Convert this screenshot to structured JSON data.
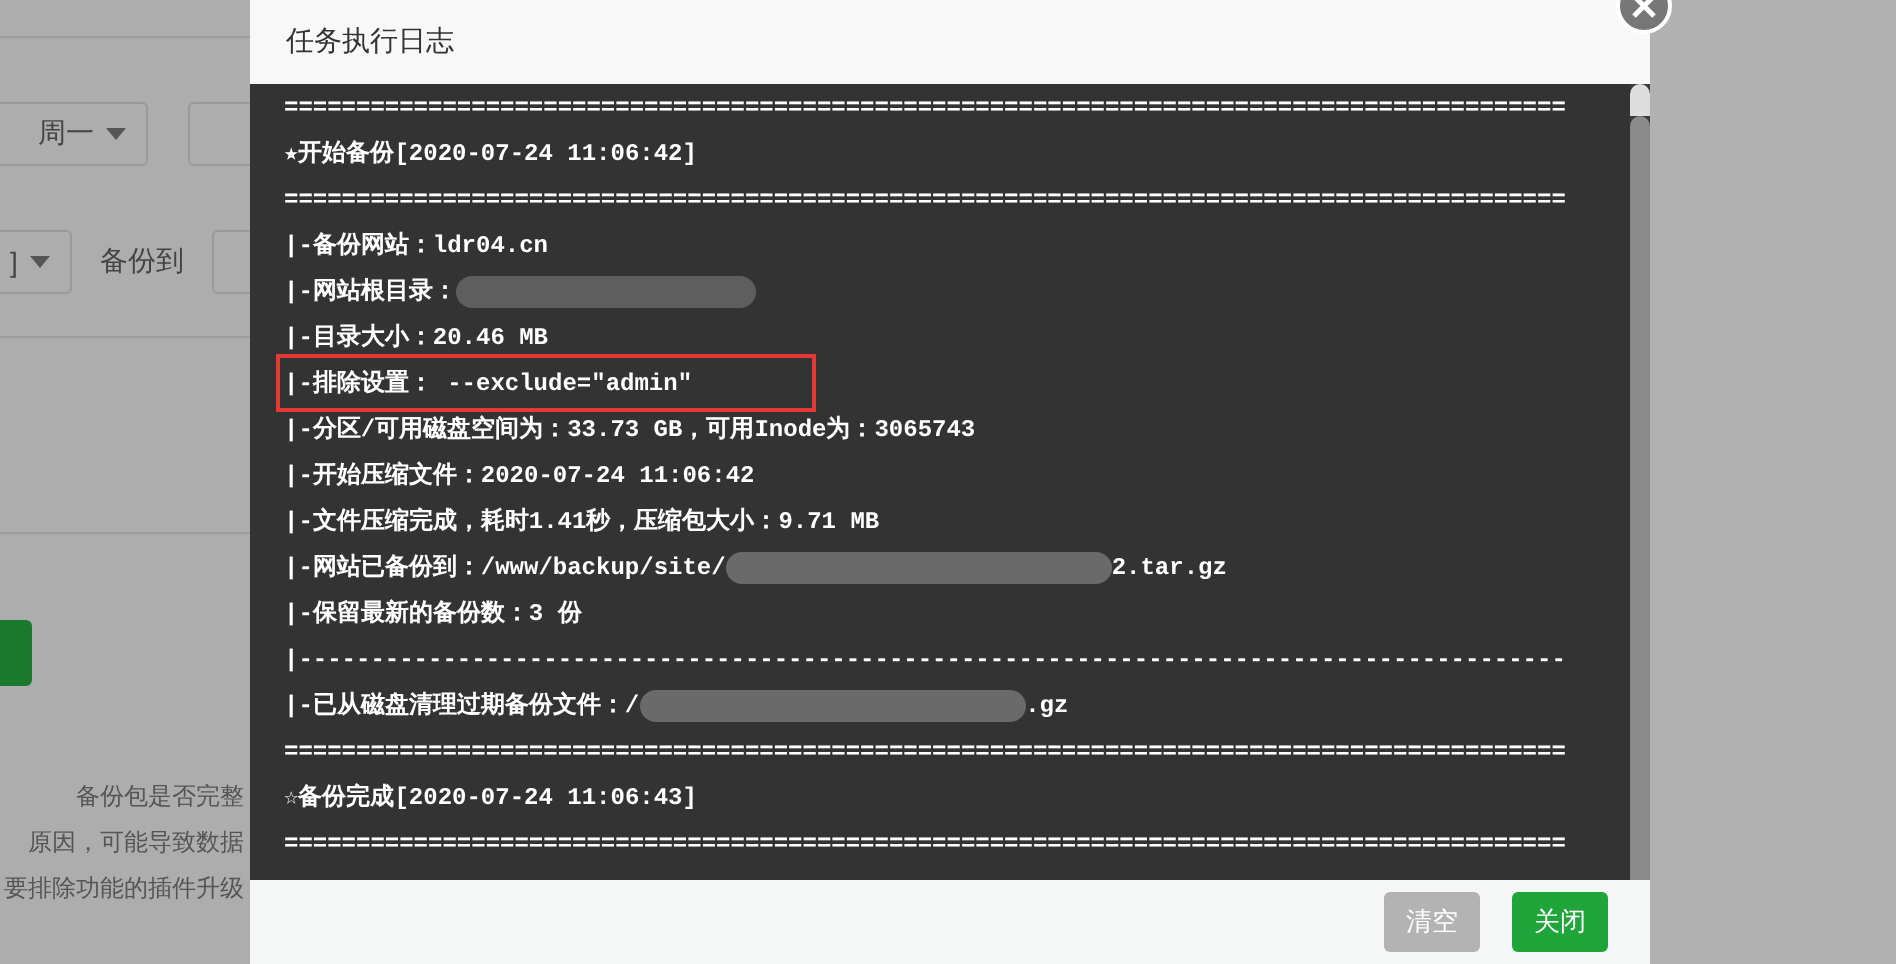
{
  "background_page": {
    "row_1": [
      {
        "kind": "dropdown",
        "label": "周一"
      },
      {
        "kind": "field"
      }
    ],
    "row_2": [
      {
        "kind": "dropdown",
        "label": "]"
      },
      {
        "kind": "label",
        "label": "备份到"
      },
      {
        "kind": "field"
      }
    ],
    "notes": [
      "备份包是否完整",
      "原因，可能导致数据",
      "要排除功能的插件升级"
    ]
  },
  "dialog": {
    "title": "任务执行日志",
    "log_lines": [
      {
        "text": "========================================================================================="
      },
      {
        "text": "★开始备份[2020-07-24 11:06:42]"
      },
      {
        "text": "========================================================================================="
      },
      {
        "text": "|-备份网站：ldr04.cn"
      },
      {
        "text": "|-网站根目录：",
        "redacted": true
      },
      {
        "text": "|-目录大小：20.46 MB"
      },
      {
        "text": "|-排除设置： --exclude=\"admin\"",
        "highlighted": true
      },
      {
        "text": "|-分区/可用磁盘空间为：33.73 GB，可用Inode为：3065743"
      },
      {
        "text": "|-开始压缩文件：2020-07-24 11:06:42"
      },
      {
        "text": "|-文件压缩完成，耗时1.41秒，压缩包大小：9.71 MB"
      },
      {
        "text": "|-网站已备份到：/www/backup/site/",
        "redacted": true,
        "tail": "2.tar.gz"
      },
      {
        "text": "|-保留最新的备份数：3 份"
      },
      {
        "text": "|----------------------------------------------------------------------------------------"
      },
      {
        "text": "|-已从磁盘清理过期备份文件：/",
        "redacted": true,
        "tail": ".gz"
      },
      {
        "text": "========================================================================================="
      },
      {
        "text": "☆备份完成[2020-07-24 11:06:43]"
      },
      {
        "text": "========================================================================================="
      }
    ],
    "buttons": [
      {
        "label": "清空",
        "disabled": true
      },
      {
        "label": "关闭",
        "disabled": false
      }
    ]
  }
}
